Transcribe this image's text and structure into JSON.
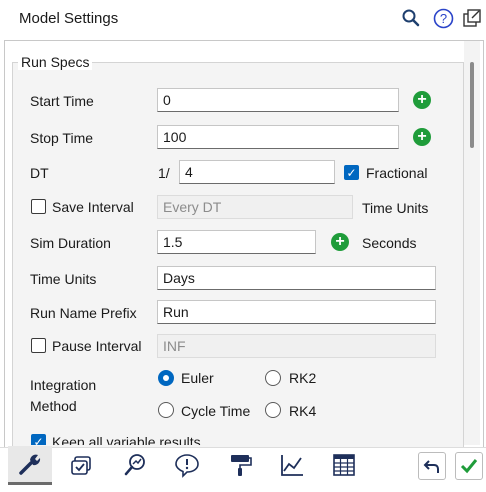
{
  "header": {
    "title": "Model Settings",
    "icons": [
      "search-icon",
      "help-icon",
      "popout-icon"
    ]
  },
  "run_specs": {
    "legend": "Run Specs",
    "start_time": {
      "label": "Start Time",
      "value": "0"
    },
    "stop_time": {
      "label": "Stop Time",
      "value": "100"
    },
    "dt": {
      "label": "DT",
      "prefix": "1/",
      "value": "4",
      "fractional_label": "Fractional",
      "fractional_checked": true
    },
    "save_interval": {
      "label": "Save Interval",
      "checked": false,
      "placeholder": "Every DT",
      "units": "Time Units"
    },
    "sim_duration": {
      "label": "Sim Duration",
      "value": "1.5",
      "units": "Seconds"
    },
    "time_units": {
      "label": "Time Units",
      "value": "Days"
    },
    "run_name_prefix": {
      "label": "Run Name Prefix",
      "value": "Run"
    },
    "pause_interval": {
      "label": "Pause Interval",
      "checked": false,
      "placeholder": "INF"
    },
    "integration": {
      "label_line1": "Integration",
      "label_line2": "Method",
      "options": [
        "Euler",
        "RK2",
        "Cycle Time",
        "RK4"
      ],
      "selected": "Euler"
    },
    "keep_all_results": {
      "label": "Keep all variable results",
      "checked": true
    }
  },
  "tabs": [
    "run-specs-tab",
    "checklist-tab",
    "analyze-tab",
    "alerts-tab",
    "paint-tab",
    "graph-tab",
    "table-tab"
  ],
  "colors": {
    "accent": "#0067c0",
    "add": "#1f9c3a",
    "ok": "#1f9c3a"
  }
}
